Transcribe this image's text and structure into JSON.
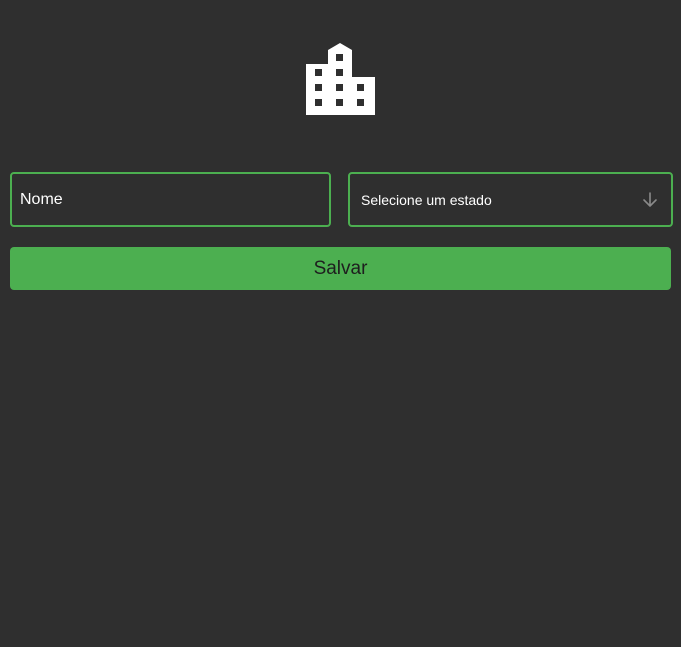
{
  "header": {
    "logo_icon": "city-building-icon"
  },
  "form": {
    "name_field": {
      "placeholder": "Nome",
      "value": ""
    },
    "state_select": {
      "selected_label": "Selecione um estado",
      "icon": "arrow-down-icon"
    },
    "save_button": {
      "label": "Salvar"
    }
  },
  "colors": {
    "background": "#2f2f2f",
    "accent": "#4caf50",
    "text": "#ffffff",
    "button_text": "#1e1e1e",
    "arrow": "#8a8a8a"
  }
}
